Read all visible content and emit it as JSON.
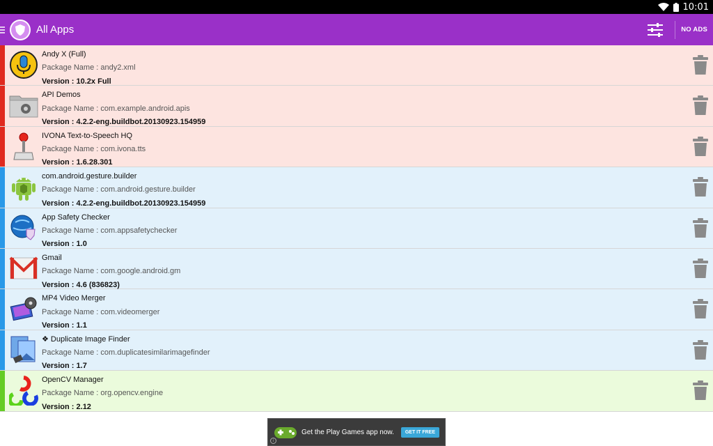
{
  "status_bar": {
    "time": "10:01"
  },
  "action_bar": {
    "title": "All Apps",
    "no_ads_label": "NO ADS"
  },
  "apps": [
    {
      "name": "Andy X (Full)",
      "package": "Package Name : andy2.xml",
      "version": "Version : 10.2x Full",
      "category": "red",
      "icon": "microphone-icon"
    },
    {
      "name": "API Demos",
      "package": "Package Name : com.example.android.apis",
      "version": "Version : 4.2.2-eng.buildbot.20130923.154959",
      "category": "red",
      "icon": "gear-folder-icon"
    },
    {
      "name": "IVONA Text-to-Speech HQ",
      "package": "Package Name : com.ivona.tts",
      "version": "Version : 1.6.28.301",
      "category": "red",
      "icon": "joystick-icon"
    },
    {
      "name": "com.android.gesture.builder",
      "package": "Package Name : com.android.gesture.builder",
      "version": "Version : 4.2.2-eng.buildbot.20130923.154959",
      "category": "blue",
      "icon": "android-robot-icon"
    },
    {
      "name": "App Safety Checker",
      "package": "Package Name : com.appsafetychecker",
      "version": "Version : 1.0",
      "category": "blue",
      "icon": "globe-shield-icon"
    },
    {
      "name": "Gmail",
      "package": "Package Name : com.google.android.gm",
      "version": "Version : 4.6 (836823)",
      "category": "blue",
      "icon": "gmail-icon"
    },
    {
      "name": "MP4 Video Merger",
      "package": "Package Name : com.videomerger",
      "version": "Version : 1.1",
      "category": "blue",
      "icon": "film-reel-icon"
    },
    {
      "name": "❖ Duplicate Image Finder",
      "package": "Package Name : com.duplicatesimilarimagefinder",
      "version": "Version : 1.7",
      "category": "blue",
      "icon": "photos-icon"
    },
    {
      "name": "OpenCV Manager",
      "package": "Package Name : org.opencv.engine",
      "version": "Version : 2.12",
      "category": "green",
      "icon": "opencv-icon"
    }
  ],
  "ad": {
    "text": "Get the Play Games app now.",
    "button": "GET IT FREE"
  },
  "colors": {
    "action_bar": "#9a30c8",
    "red_stripe": "#e02a1f",
    "blue_stripe": "#2a99e8",
    "green_stripe": "#65cc25"
  }
}
